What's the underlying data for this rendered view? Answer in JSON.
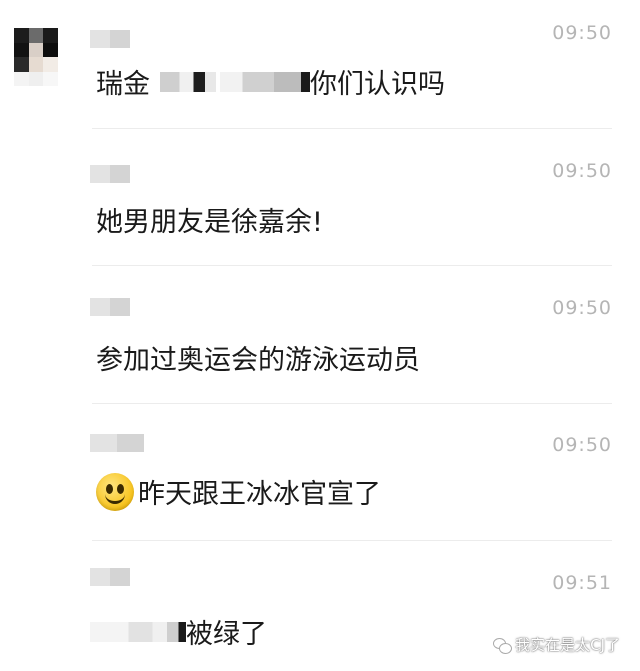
{
  "messages": [
    {
      "time": "09:50",
      "pre": "瑞金",
      "post": "你们认识吗"
    },
    {
      "time": "09:50",
      "text": "她男朋友是徐嘉余!"
    },
    {
      "time": "09:50",
      "text": "参加过奥运会的游泳运动员"
    },
    {
      "time": "09:50",
      "text": "昨天跟王冰冰官宣了",
      "icon": "smiley-emoji"
    },
    {
      "time": "09:51",
      "text": "被绿了"
    }
  ],
  "watermark": {
    "text": "我实在是太CJ了",
    "icon": "wechat-icon"
  }
}
